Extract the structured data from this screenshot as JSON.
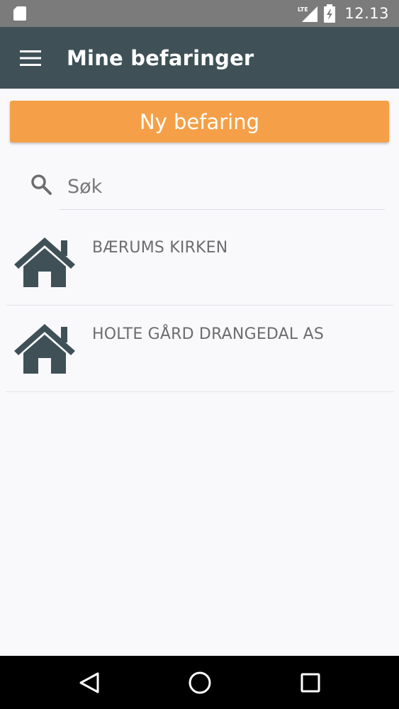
{
  "status_bar": {
    "network": "LTE",
    "time": "12.13"
  },
  "app_bar": {
    "title": "Mine befaringer"
  },
  "actions": {
    "new_label": "Ny befaring"
  },
  "search": {
    "placeholder": "Søk",
    "value": ""
  },
  "list": {
    "items": [
      {
        "name": "BÆRUMS KIRKEN",
        "icon": "house-icon"
      },
      {
        "name": "HOLTE GÅRD DRANGEDAL AS",
        "icon": "house-icon"
      }
    ]
  },
  "colors": {
    "status_bar": "#7b7b7b",
    "app_bar": "#3f5157",
    "accent": "#f5a048",
    "icon": "#3f5157",
    "text": "#6d6d6d",
    "background": "#f9f8fb"
  }
}
